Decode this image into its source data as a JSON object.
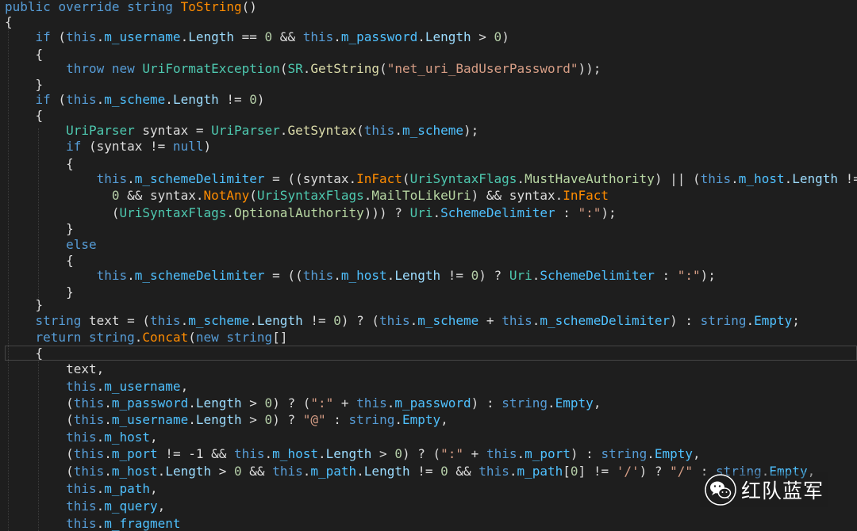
{
  "code_lines": [
    [
      [
        "kw",
        "public"
      ],
      [
        "plain",
        " "
      ],
      [
        "kw",
        "override"
      ],
      [
        "plain",
        " "
      ],
      [
        "kw",
        "string"
      ],
      [
        "plain",
        " "
      ],
      [
        "ext",
        "ToString"
      ],
      [
        "plain",
        "()"
      ]
    ],
    [
      [
        "plain",
        "{"
      ]
    ],
    [
      [
        "plain",
        "    "
      ],
      [
        "kw",
        "if"
      ],
      [
        "plain",
        " ("
      ],
      [
        "kw",
        "this"
      ],
      [
        "plain",
        "."
      ],
      [
        "field",
        "m_username"
      ],
      [
        "plain",
        "."
      ],
      [
        "member",
        "Length"
      ],
      [
        "plain",
        " == "
      ],
      [
        "num",
        "0"
      ],
      [
        "plain",
        " && "
      ],
      [
        "kw",
        "this"
      ],
      [
        "plain",
        "."
      ],
      [
        "field",
        "m_password"
      ],
      [
        "plain",
        "."
      ],
      [
        "member",
        "Length"
      ],
      [
        "plain",
        " > "
      ],
      [
        "num",
        "0"
      ],
      [
        "plain",
        ")"
      ]
    ],
    [
      [
        "plain",
        "    {"
      ]
    ],
    [
      [
        "plain",
        "        "
      ],
      [
        "kw",
        "throw"
      ],
      [
        "plain",
        " "
      ],
      [
        "kw",
        "new"
      ],
      [
        "plain",
        " "
      ],
      [
        "type",
        "UriFormatException"
      ],
      [
        "plain",
        "("
      ],
      [
        "type",
        "SR"
      ],
      [
        "plain",
        "."
      ],
      [
        "method",
        "GetString"
      ],
      [
        "plain",
        "("
      ],
      [
        "str",
        "\"net_uri_BadUserPassword\""
      ],
      [
        "plain",
        "));"
      ]
    ],
    [
      [
        "plain",
        "    }"
      ]
    ],
    [
      [
        "plain",
        "    "
      ],
      [
        "kw",
        "if"
      ],
      [
        "plain",
        " ("
      ],
      [
        "kw",
        "this"
      ],
      [
        "plain",
        "."
      ],
      [
        "field",
        "m_scheme"
      ],
      [
        "plain",
        "."
      ],
      [
        "member",
        "Length"
      ],
      [
        "plain",
        " != "
      ],
      [
        "num",
        "0"
      ],
      [
        "plain",
        ")"
      ]
    ],
    [
      [
        "plain",
        "    {"
      ]
    ],
    [
      [
        "plain",
        "        "
      ],
      [
        "type",
        "UriParser"
      ],
      [
        "plain",
        " syntax = "
      ],
      [
        "type",
        "UriParser"
      ],
      [
        "plain",
        "."
      ],
      [
        "method",
        "GetSyntax"
      ],
      [
        "plain",
        "("
      ],
      [
        "kw",
        "this"
      ],
      [
        "plain",
        "."
      ],
      [
        "field",
        "m_scheme"
      ],
      [
        "plain",
        ");"
      ]
    ],
    [
      [
        "plain",
        "        "
      ],
      [
        "kw",
        "if"
      ],
      [
        "plain",
        " (syntax != "
      ],
      [
        "kw",
        "null"
      ],
      [
        "plain",
        ")"
      ]
    ],
    [
      [
        "plain",
        "        {"
      ]
    ],
    [
      [
        "plain",
        "            "
      ],
      [
        "kw",
        "this"
      ],
      [
        "plain",
        "."
      ],
      [
        "field",
        "m_schemeDelimiter"
      ],
      [
        "plain",
        " = ((syntax."
      ],
      [
        "ext",
        "InFact"
      ],
      [
        "plain",
        "("
      ],
      [
        "type",
        "UriSyntaxFlags"
      ],
      [
        "plain",
        "."
      ],
      [
        "enum",
        "MustHaveAuthority"
      ],
      [
        "plain",
        ") || ("
      ],
      [
        "kw",
        "this"
      ],
      [
        "plain",
        "."
      ],
      [
        "field",
        "m_host"
      ],
      [
        "plain",
        "."
      ],
      [
        "member",
        "Length"
      ],
      [
        "plain",
        " !="
      ]
    ],
    [
      [
        "plain",
        "              "
      ],
      [
        "num",
        "0"
      ],
      [
        "plain",
        " && syntax."
      ],
      [
        "ext",
        "NotAny"
      ],
      [
        "plain",
        "("
      ],
      [
        "type",
        "UriSyntaxFlags"
      ],
      [
        "plain",
        "."
      ],
      [
        "enum",
        "MailToLikeUri"
      ],
      [
        "plain",
        ") && syntax."
      ],
      [
        "ext",
        "InFact"
      ]
    ],
    [
      [
        "plain",
        "              ("
      ],
      [
        "type",
        "UriSyntaxFlags"
      ],
      [
        "plain",
        "."
      ],
      [
        "enum",
        "OptionalAuthority"
      ],
      [
        "plain",
        "))) ? "
      ],
      [
        "type",
        "Uri"
      ],
      [
        "plain",
        "."
      ],
      [
        "field",
        "SchemeDelimiter"
      ],
      [
        "plain",
        " : "
      ],
      [
        "str",
        "\":\""
      ],
      [
        "plain",
        ");"
      ]
    ],
    [
      [
        "plain",
        "        }"
      ]
    ],
    [
      [
        "plain",
        "        "
      ],
      [
        "kw",
        "else"
      ]
    ],
    [
      [
        "plain",
        "        {"
      ]
    ],
    [
      [
        "plain",
        "            "
      ],
      [
        "kw",
        "this"
      ],
      [
        "plain",
        "."
      ],
      [
        "field",
        "m_schemeDelimiter"
      ],
      [
        "plain",
        " = (("
      ],
      [
        "kw",
        "this"
      ],
      [
        "plain",
        "."
      ],
      [
        "field",
        "m_host"
      ],
      [
        "plain",
        "."
      ],
      [
        "member",
        "Length"
      ],
      [
        "plain",
        " != "
      ],
      [
        "num",
        "0"
      ],
      [
        "plain",
        ") ? "
      ],
      [
        "type",
        "Uri"
      ],
      [
        "plain",
        "."
      ],
      [
        "field",
        "SchemeDelimiter"
      ],
      [
        "plain",
        " : "
      ],
      [
        "str",
        "\":\""
      ],
      [
        "plain",
        ");"
      ]
    ],
    [
      [
        "plain",
        "        }"
      ]
    ],
    [
      [
        "plain",
        "    }"
      ]
    ],
    [
      [
        "plain",
        "    "
      ],
      [
        "kw",
        "string"
      ],
      [
        "plain",
        " text = ("
      ],
      [
        "kw",
        "this"
      ],
      [
        "plain",
        "."
      ],
      [
        "field",
        "m_scheme"
      ],
      [
        "plain",
        "."
      ],
      [
        "member",
        "Length"
      ],
      [
        "plain",
        " != "
      ],
      [
        "num",
        "0"
      ],
      [
        "plain",
        ") ? ("
      ],
      [
        "kw",
        "this"
      ],
      [
        "plain",
        "."
      ],
      [
        "field",
        "m_scheme"
      ],
      [
        "plain",
        " + "
      ],
      [
        "kw",
        "this"
      ],
      [
        "plain",
        "."
      ],
      [
        "field",
        "m_schemeDelimiter"
      ],
      [
        "plain",
        ") : "
      ],
      [
        "kw",
        "string"
      ],
      [
        "plain",
        "."
      ],
      [
        "field",
        "Empty"
      ],
      [
        "plain",
        ";"
      ]
    ],
    [
      [
        "plain",
        "    "
      ],
      [
        "kw",
        "return"
      ],
      [
        "plain",
        " "
      ],
      [
        "kw",
        "string"
      ],
      [
        "plain",
        "."
      ],
      [
        "ext",
        "Concat"
      ],
      [
        "plain",
        "("
      ],
      [
        "kw",
        "new"
      ],
      [
        "plain",
        " "
      ],
      [
        "kw",
        "string"
      ],
      [
        "plain",
        "[]"
      ]
    ],
    [
      [
        "plain",
        "    {"
      ]
    ],
    [
      [
        "plain",
        "        text,"
      ]
    ],
    [
      [
        "plain",
        "        "
      ],
      [
        "kw",
        "this"
      ],
      [
        "plain",
        "."
      ],
      [
        "field",
        "m_username"
      ],
      [
        "plain",
        ","
      ]
    ],
    [
      [
        "plain",
        "        ("
      ],
      [
        "kw",
        "this"
      ],
      [
        "plain",
        "."
      ],
      [
        "field",
        "m_password"
      ],
      [
        "plain",
        "."
      ],
      [
        "member",
        "Length"
      ],
      [
        "plain",
        " > "
      ],
      [
        "num",
        "0"
      ],
      [
        "plain",
        ") ? ("
      ],
      [
        "str",
        "\":\""
      ],
      [
        "plain",
        " + "
      ],
      [
        "kw",
        "this"
      ],
      [
        "plain",
        "."
      ],
      [
        "field",
        "m_password"
      ],
      [
        "plain",
        ") : "
      ],
      [
        "kw",
        "string"
      ],
      [
        "plain",
        "."
      ],
      [
        "field",
        "Empty"
      ],
      [
        "plain",
        ","
      ]
    ],
    [
      [
        "plain",
        "        ("
      ],
      [
        "kw",
        "this"
      ],
      [
        "plain",
        "."
      ],
      [
        "field",
        "m_username"
      ],
      [
        "plain",
        "."
      ],
      [
        "member",
        "Length"
      ],
      [
        "plain",
        " > "
      ],
      [
        "num",
        "0"
      ],
      [
        "plain",
        ") ? "
      ],
      [
        "str",
        "\"@\""
      ],
      [
        "plain",
        " : "
      ],
      [
        "kw",
        "string"
      ],
      [
        "plain",
        "."
      ],
      [
        "field",
        "Empty"
      ],
      [
        "plain",
        ","
      ]
    ],
    [
      [
        "plain",
        "        "
      ],
      [
        "kw",
        "this"
      ],
      [
        "plain",
        "."
      ],
      [
        "field",
        "m_host"
      ],
      [
        "plain",
        ","
      ]
    ],
    [
      [
        "plain",
        "        ("
      ],
      [
        "kw",
        "this"
      ],
      [
        "plain",
        "."
      ],
      [
        "field",
        "m_port"
      ],
      [
        "plain",
        " != -1 && "
      ],
      [
        "kw",
        "this"
      ],
      [
        "plain",
        "."
      ],
      [
        "field",
        "m_host"
      ],
      [
        "plain",
        "."
      ],
      [
        "member",
        "Length"
      ],
      [
        "plain",
        " > "
      ],
      [
        "num",
        "0"
      ],
      [
        "plain",
        ") ? ("
      ],
      [
        "str",
        "\":\""
      ],
      [
        "plain",
        " + "
      ],
      [
        "kw",
        "this"
      ],
      [
        "plain",
        "."
      ],
      [
        "field",
        "m_port"
      ],
      [
        "plain",
        ") : "
      ],
      [
        "kw",
        "string"
      ],
      [
        "plain",
        "."
      ],
      [
        "field",
        "Empty"
      ],
      [
        "plain",
        ","
      ]
    ],
    [
      [
        "plain",
        "        ("
      ],
      [
        "kw",
        "this"
      ],
      [
        "plain",
        "."
      ],
      [
        "field",
        "m_host"
      ],
      [
        "plain",
        "."
      ],
      [
        "member",
        "Length"
      ],
      [
        "plain",
        " > "
      ],
      [
        "num",
        "0"
      ],
      [
        "plain",
        " && "
      ],
      [
        "kw",
        "this"
      ],
      [
        "plain",
        "."
      ],
      [
        "field",
        "m_path"
      ],
      [
        "plain",
        "."
      ],
      [
        "member",
        "Length"
      ],
      [
        "plain",
        " != "
      ],
      [
        "num",
        "0"
      ],
      [
        "plain",
        " && "
      ],
      [
        "kw",
        "this"
      ],
      [
        "plain",
        "."
      ],
      [
        "field",
        "m_path"
      ],
      [
        "plain",
        "["
      ],
      [
        "num",
        "0"
      ],
      [
        "plain",
        "] != "
      ],
      [
        "str",
        "'/'"
      ],
      [
        "plain",
        ") ? "
      ],
      [
        "str",
        "\"/\""
      ],
      [
        "plain",
        " : "
      ],
      [
        "kw",
        "string"
      ],
      [
        "plain",
        "."
      ],
      [
        "field",
        "Empty"
      ],
      [
        "plain",
        ","
      ]
    ],
    [
      [
        "plain",
        "        "
      ],
      [
        "kw",
        "this"
      ],
      [
        "plain",
        "."
      ],
      [
        "field",
        "m_path"
      ],
      [
        "plain",
        ","
      ]
    ],
    [
      [
        "plain",
        "        "
      ],
      [
        "kw",
        "this"
      ],
      [
        "plain",
        "."
      ],
      [
        "field",
        "m_query"
      ],
      [
        "plain",
        ","
      ]
    ],
    [
      [
        "plain",
        "        "
      ],
      [
        "kw",
        "this"
      ],
      [
        "plain",
        "."
      ],
      [
        "field",
        "m_fragment"
      ]
    ]
  ],
  "watermark": {
    "text": "红队蓝军",
    "icon": "wechat-icon"
  }
}
